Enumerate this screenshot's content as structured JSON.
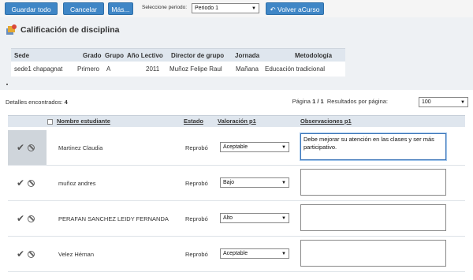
{
  "toolbar": {
    "save_all": "Guardar todo",
    "cancel": "Cancelar",
    "more": "Más...",
    "period_label": "Seleccione periodo:",
    "period_value": "Periodo 1",
    "back": "Volver aCurso"
  },
  "page_title": "Calificación de disciplina",
  "info": {
    "headers": [
      "Sede",
      "Grado",
      "Grupo",
      "Año Lectivo",
      "Director de grupo",
      "Jornada",
      "Metodología"
    ],
    "row": [
      "sede1 chapagnat",
      "Primero",
      "A",
      "2011",
      "Muñoz Felipe Raul",
      "Mañana",
      "Educación tradicional"
    ]
  },
  "pager": {
    "found_label": "Detalles encontrados:",
    "found_count": "4",
    "page_word": "Página",
    "page_current": "1",
    "page_sep": "/",
    "page_total": "1",
    "per_page_label": "Resultados por página:",
    "per_page_value": "100"
  },
  "grid": {
    "headers": {
      "name": "Nombre estudiante",
      "estado": "Estado",
      "valoracion": "Valoración p1",
      "observaciones": "Observaciones p1"
    },
    "rows": [
      {
        "name": "Martinez Claudia",
        "estado": "Reprobó",
        "valoracion": "Aceptable",
        "obs": "Debe mejorar su atención en las clases y ser más participativo."
      },
      {
        "name": "muñoz andres",
        "estado": "Reprobó",
        "valoracion": "Bajo",
        "obs": ""
      },
      {
        "name": "PERAFAN SANCHEZ LEIDY FERNANDA",
        "estado": "Reprobó",
        "valoracion": "Alto",
        "obs": ""
      },
      {
        "name": "Velez Hérnan",
        "estado": "Reprobó",
        "valoracion": "Aceptable",
        "obs": ""
      }
    ]
  },
  "icons": {
    "check": "check-icon",
    "cancel": "ban-icon",
    "caret": "caret-down-icon",
    "back": "back-arrow-icon",
    "title": "discipline-icon"
  },
  "colors": {
    "button": "#3f86c6",
    "header_band": "#dfe6ee",
    "title_area": "#eef1f4"
  }
}
